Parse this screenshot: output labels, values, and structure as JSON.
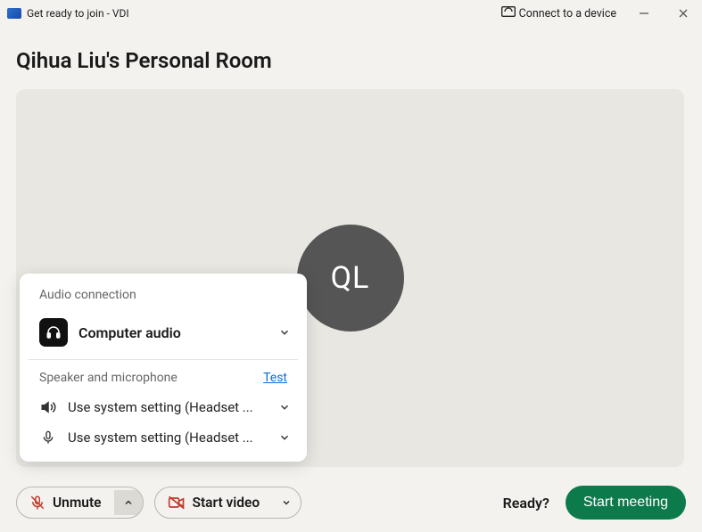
{
  "titlebar": {
    "title": "Get ready to join - VDI",
    "connect_device": "Connect to a device"
  },
  "room_title": "Qihua Liu's Personal Room",
  "avatar_initials": "QL",
  "audio_panel": {
    "header": "Audio connection",
    "mode_label": "Computer audio",
    "sub_header": "Speaker and microphone",
    "test_link": "Test",
    "speaker_label": "Use system setting (Headset ...",
    "mic_label": "Use system setting (Headset ..."
  },
  "controls": {
    "unmute_label": "Unmute",
    "start_video_label": "Start video",
    "ready_label": "Ready?",
    "start_meeting_label": "Start meeting"
  }
}
